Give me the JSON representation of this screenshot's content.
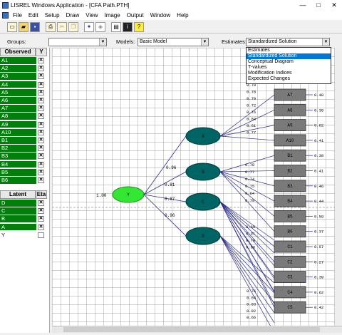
{
  "window": {
    "title": "LISREL Windows Application - [CFA Path.PTH]",
    "controls": [
      "—",
      "□",
      "✕"
    ]
  },
  "menu": [
    "File",
    "Edit",
    "Setup",
    "Draw",
    "View",
    "Image",
    "Output",
    "Window",
    "Help"
  ],
  "toolbar": [
    "new",
    "open",
    "save",
    "print",
    "cut",
    "copy",
    "paste",
    "run",
    "question"
  ],
  "groups": {
    "label": "Groups:",
    "value": ""
  },
  "models": {
    "label": "Models:",
    "value": "Basic Model"
  },
  "estimates": {
    "label": "Estimates:",
    "value": "Standardized Solution",
    "options": [
      "Estimates",
      "Standardized Solution",
      "Conceptual Diagram",
      "T-values",
      "Modification Indices",
      "Expected Changes"
    ],
    "selected_index": 1
  },
  "observed": {
    "header": "Observed",
    "col": "Y",
    "items": [
      "A1",
      "A2",
      "A3",
      "A4",
      "A5",
      "A6",
      "A7",
      "A8",
      "A9",
      "A10",
      "B1",
      "B2",
      "B3",
      "B4",
      "B5",
      "B6"
    ]
  },
  "latent": {
    "header": "Latent",
    "col": "Eta",
    "items": [
      {
        "name": "D",
        "checked": true
      },
      {
        "name": "C",
        "checked": true
      },
      {
        "name": "B",
        "checked": true
      },
      {
        "name": "A",
        "checked": true
      },
      {
        "name": "Y",
        "checked": false
      }
    ]
  },
  "diagram": {
    "Y": {
      "label": "Y",
      "variance": "1.00"
    },
    "paths": [
      {
        "to": "A",
        "value": "0.96"
      },
      {
        "to": "B",
        "value": "0.81"
      },
      {
        "to": "C",
        "value": "0.87"
      },
      {
        "to": "D",
        "value": "0.96"
      }
    ],
    "factors": [
      "A",
      "B",
      "C",
      "D"
    ],
    "indicators": [
      {
        "name": "A7",
        "err": "0.48"
      },
      {
        "name": "A8",
        "err": "0.30"
      },
      {
        "name": "A9",
        "err": "0.62"
      },
      {
        "name": "A10",
        "err": "0.41"
      },
      {
        "name": "B1",
        "err": "0.38"
      },
      {
        "name": "B2",
        "err": "0.41"
      },
      {
        "name": "B3",
        "err": "0.46"
      },
      {
        "name": "B4",
        "err": "0.44"
      },
      {
        "name": "B5",
        "err": "0.59"
      },
      {
        "name": "B6",
        "err": "0.37"
      },
      {
        "name": "C1",
        "err": "0.57"
      },
      {
        "name": "C2",
        "err": "0.27"
      },
      {
        "name": "C3",
        "err": "0.39"
      },
      {
        "name": "C4",
        "err": "0.62"
      },
      {
        "name": "C5",
        "err": "0.42"
      }
    ],
    "loadings_A": [
      "0.79",
      "0.78",
      "0.79",
      "0.72",
      "0.76",
      "0.84",
      "0.61",
      "0.77"
    ],
    "loadings_B": [
      "0.78",
      "0.77",
      "0.74",
      "0.75",
      "0.64",
      "0.79"
    ],
    "loadings_C": [
      "0.65",
      "0.91",
      "0.78",
      "0.66"
    ],
    "loadings_D": [
      "0.76",
      "0.64",
      "0.83",
      "0.82",
      "0.66"
    ]
  }
}
